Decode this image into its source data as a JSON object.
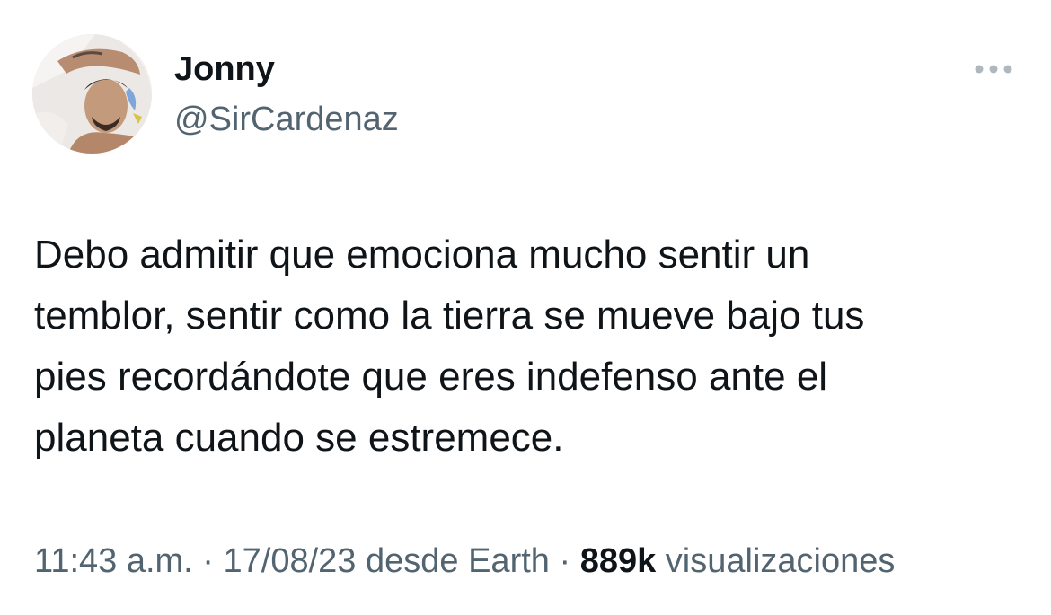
{
  "author": {
    "name": "Jonny",
    "handle": "@SirCardenaz",
    "avatar_icon": "profile-photo"
  },
  "more_icon": "ellipsis-horizontal-icon",
  "tweet": {
    "text": "Debo admitir que emociona mucho sentir un\ntemblor, sentir como la tierra se mueve bajo tus\npies recordándote que eres indefenso ante el\nplaneta cuando se estremece."
  },
  "meta": {
    "time": "11:43 a.m.",
    "sep1": " · ",
    "date": "17/08/23",
    "source": " desde Earth",
    "sep2": " · ",
    "views_count": "889k",
    "views_label": " visualizaciones"
  },
  "colors": {
    "primary_text": "#0f1419",
    "secondary_text": "#536471"
  }
}
